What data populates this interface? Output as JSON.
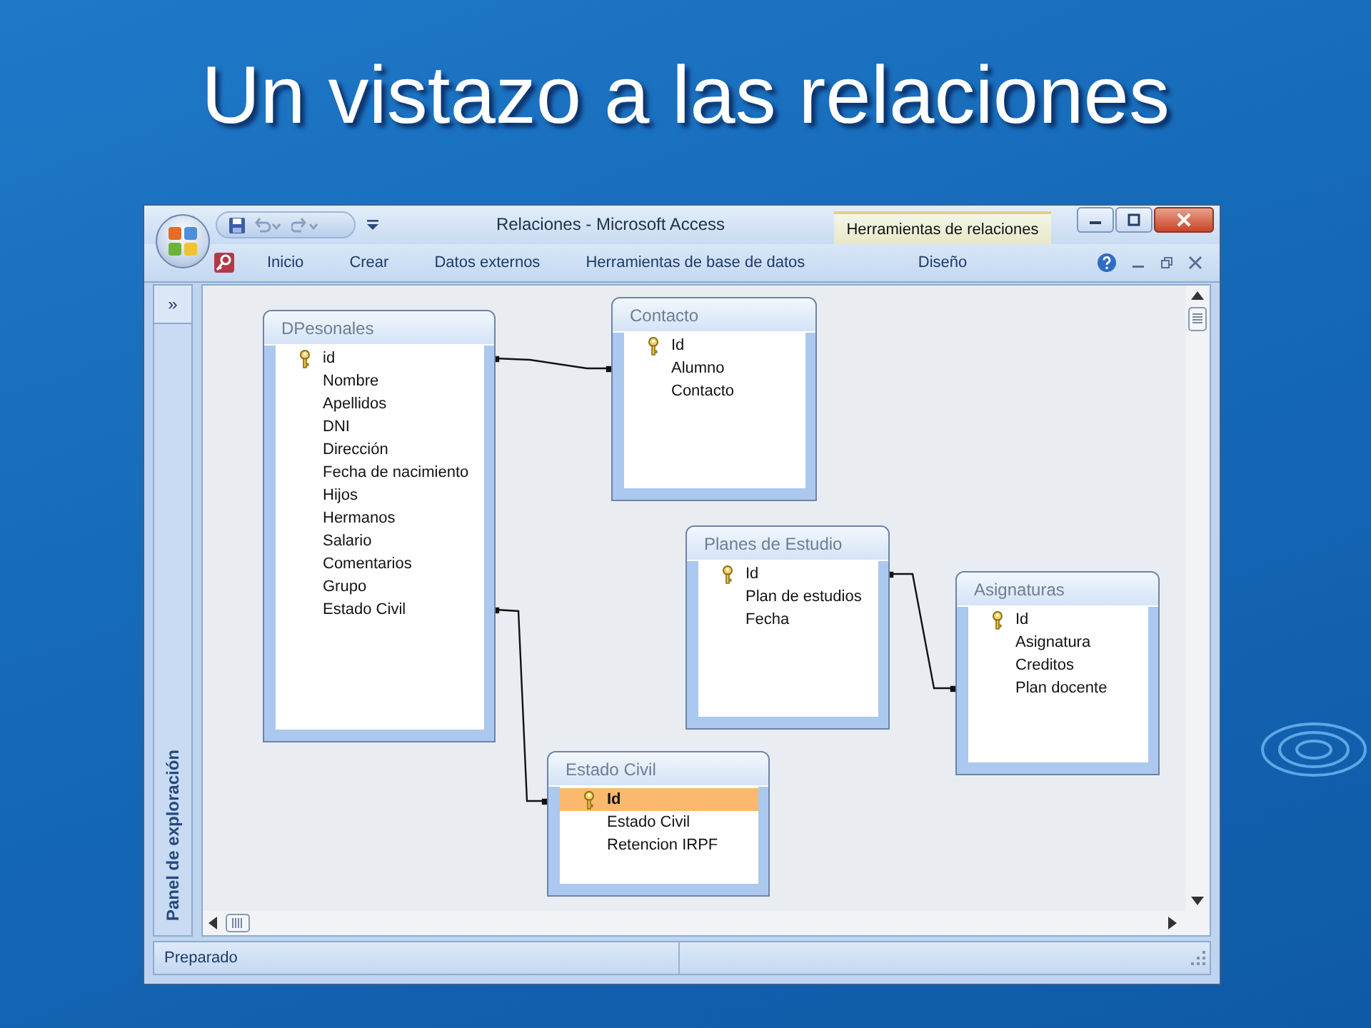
{
  "slide": {
    "title": "Un vistazo a las relaciones"
  },
  "window": {
    "title": "Relaciones - Microsoft Access",
    "contextual_tab": "Herramientas de relaciones",
    "ribbon_tabs": [
      {
        "label": "Inicio",
        "selected": false
      },
      {
        "label": "Crear",
        "selected": false
      },
      {
        "label": "Datos externos",
        "selected": false
      },
      {
        "label": "Herramientas de base de datos",
        "selected": false
      },
      {
        "label": "Diseño",
        "selected": false
      }
    ],
    "nav_pane": {
      "toggle": "»",
      "label": "Panel de exploración"
    },
    "tables": [
      {
        "name": "DPesonales",
        "fields": [
          {
            "name": "id",
            "primary_key": true,
            "selected": false
          },
          {
            "name": "Nombre",
            "primary_key": false,
            "selected": false
          },
          {
            "name": "Apellidos",
            "primary_key": false,
            "selected": false
          },
          {
            "name": "DNI",
            "primary_key": false,
            "selected": false
          },
          {
            "name": "Dirección",
            "primary_key": false,
            "selected": false
          },
          {
            "name": "Fecha de nacimiento",
            "primary_key": false,
            "selected": false
          },
          {
            "name": "Hijos",
            "primary_key": false,
            "selected": false
          },
          {
            "name": "Hermanos",
            "primary_key": false,
            "selected": false
          },
          {
            "name": "Salario",
            "primary_key": false,
            "selected": false
          },
          {
            "name": "Comentarios",
            "primary_key": false,
            "selected": false
          },
          {
            "name": "Grupo",
            "primary_key": false,
            "selected": false
          },
          {
            "name": "Estado Civil",
            "primary_key": false,
            "selected": false
          }
        ]
      },
      {
        "name": "Contacto",
        "fields": [
          {
            "name": "Id",
            "primary_key": true,
            "selected": false
          },
          {
            "name": "Alumno",
            "primary_key": false,
            "selected": false
          },
          {
            "name": "Contacto",
            "primary_key": false,
            "selected": false
          }
        ]
      },
      {
        "name": "Planes de Estudio",
        "fields": [
          {
            "name": "Id",
            "primary_key": true,
            "selected": false
          },
          {
            "name": "Plan de estudios",
            "primary_key": false,
            "selected": false
          },
          {
            "name": "Fecha",
            "primary_key": false,
            "selected": false
          }
        ]
      },
      {
        "name": "Asignaturas",
        "fields": [
          {
            "name": "Id",
            "primary_key": true,
            "selected": false
          },
          {
            "name": "Asignatura",
            "primary_key": false,
            "selected": false
          },
          {
            "name": "Creditos",
            "primary_key": false,
            "selected": false
          },
          {
            "name": "Plan docente",
            "primary_key": false,
            "selected": false
          }
        ]
      },
      {
        "name": "Estado Civil",
        "fields": [
          {
            "name": "Id",
            "primary_key": true,
            "selected": true
          },
          {
            "name": "Estado Civil",
            "primary_key": false,
            "selected": false
          },
          {
            "name": "Retencion IRPF",
            "primary_key": false,
            "selected": false
          }
        ]
      }
    ],
    "status_bar": "Preparado"
  }
}
